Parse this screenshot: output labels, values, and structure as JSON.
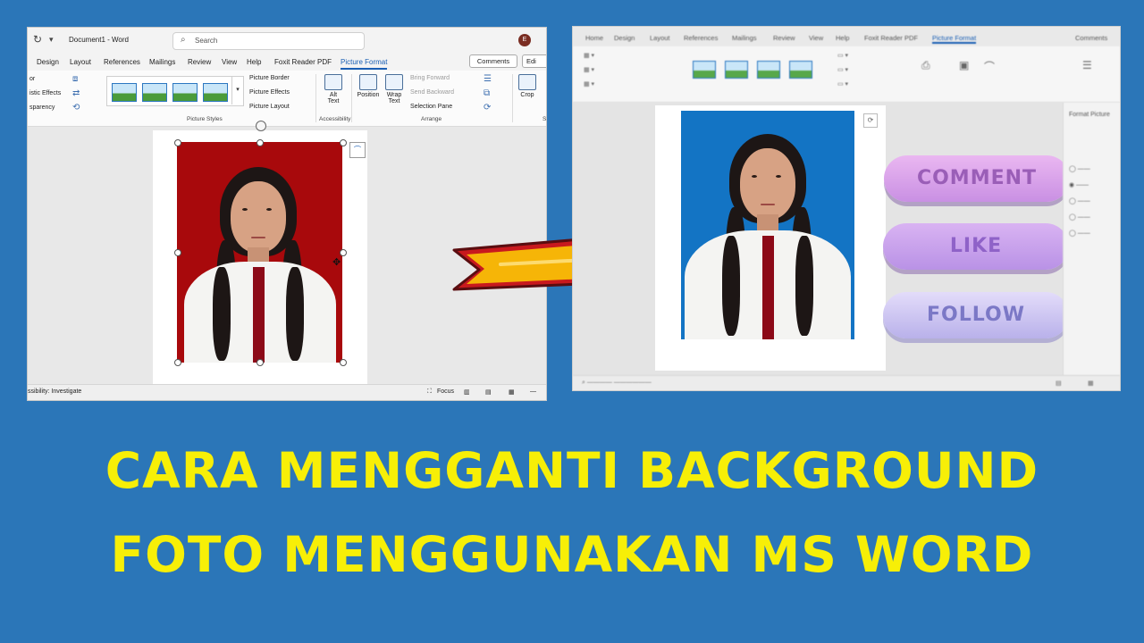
{
  "left_window": {
    "doc_title": "Document1 - Word",
    "search_placeholder": "Search",
    "tabs": [
      "Design",
      "Layout",
      "References",
      "Mailings",
      "Review",
      "View",
      "Help",
      "Foxit Reader PDF",
      "Picture Format"
    ],
    "active_tab": "Picture Format",
    "comments_label": "Comments",
    "edit_label": "Edi",
    "ribbon": {
      "adjust_items": [
        "or",
        "istic Effects",
        "sparency"
      ],
      "picture_border": "Picture Border",
      "picture_effects": "Picture Effects",
      "picture_layout": "Picture Layout",
      "picture_styles_label": "Picture Styles",
      "alt_text_line1": "Alt",
      "alt_text_line2": "Text",
      "accessibility_label": "Accessibility",
      "position_label": "Position",
      "wrap_text_line1": "Wrap",
      "wrap_text_line2": "Text",
      "bring_forward": "Bring Forward",
      "send_backward": "Send Backward",
      "selection_pane": "Selection Pane",
      "arrange_label": "Arrange",
      "crop_label": "Crop",
      "size_label": "S"
    },
    "status_text": "ssibility: Investigate",
    "focus_label": "Focus",
    "avatar_initial": "E",
    "photo_background_color": "#a8090c"
  },
  "right_window": {
    "tabs": [
      "Home",
      "Design",
      "Layout",
      "References",
      "Mailings",
      "Review",
      "View",
      "Help",
      "Foxit Reader PDF",
      "Picture Format"
    ],
    "active_tab": "Picture Format",
    "comments_label": "Comments",
    "photo_background_color": "#1374c4",
    "social_buttons": {
      "comment": "COMMENT",
      "like": "LIKE",
      "follow": "FOLLOW"
    },
    "pane_title": "Format Picture"
  },
  "arrow": {
    "fill_color": "#f6b507",
    "outline_color": "#c8191e"
  },
  "headline": {
    "line1": "CARA MENGGANTI BACKGROUND",
    "line2": "FOTO MENGGUNAKAN MS WORD",
    "color": "#f7ef07"
  },
  "background_color": "#2b76b8"
}
